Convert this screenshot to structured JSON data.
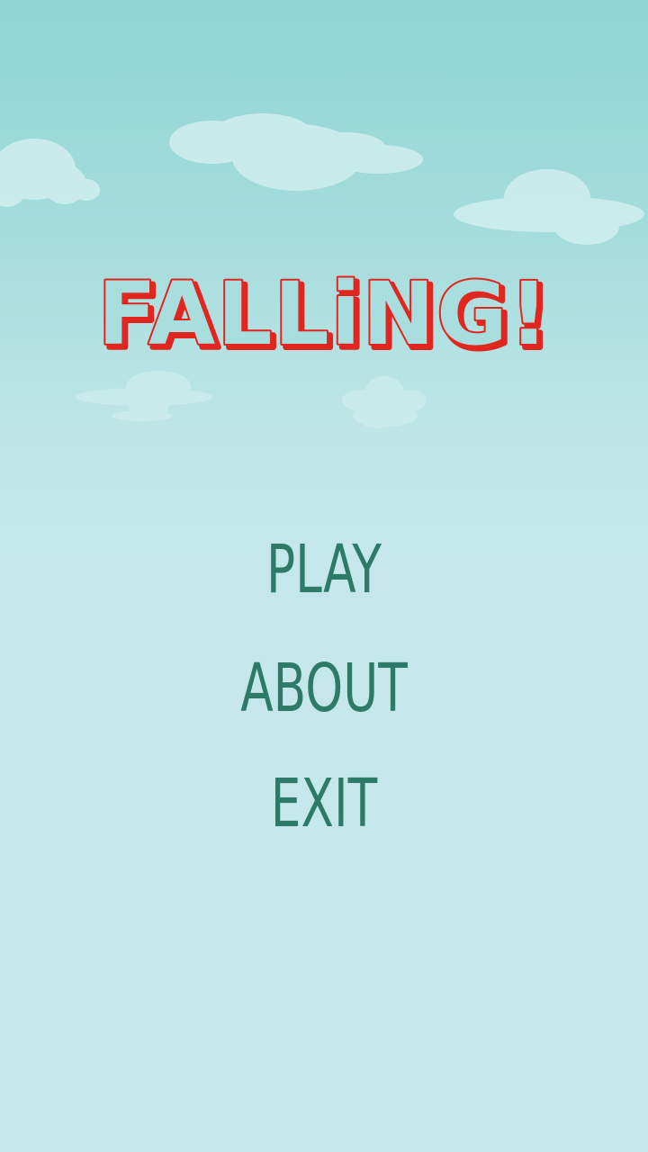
{
  "game": {
    "title": "FALLiNG!",
    "title_fill": "#a9dede",
    "title_outline": "#e0261f"
  },
  "menu": {
    "play_label": "PLAY",
    "about_label": "ABOUT",
    "exit_label": "EXIT",
    "text_color": "#2d7a68"
  },
  "sky": {
    "top_color": "#90d6d3",
    "bottom_color": "#c6e8ed",
    "cloud_color": "#d0eeee"
  }
}
